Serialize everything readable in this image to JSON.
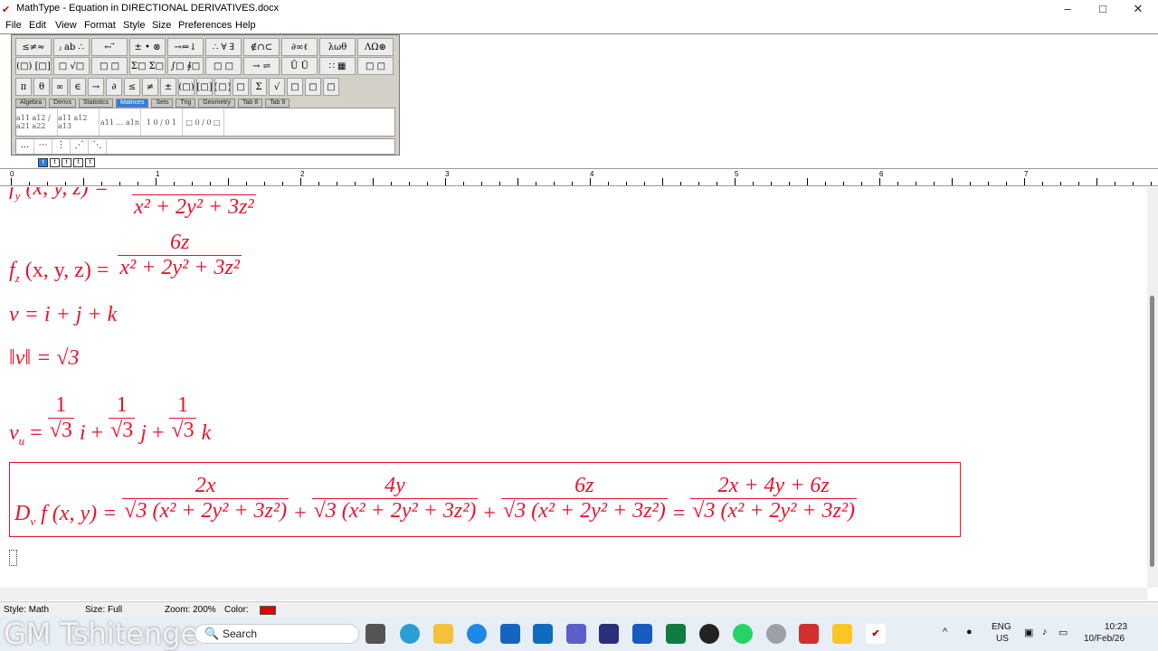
{
  "window": {
    "title": "MathType - Equation in DIRECTIONAL DERIVATIVES.docx",
    "minimize": "–",
    "maximize": "□",
    "close": "✕"
  },
  "menu": [
    "File",
    "Edit",
    "View",
    "Format",
    "Style",
    "Size",
    "Preferences",
    "Help"
  ],
  "palette": {
    "row1": [
      "≤≠≈",
      "ⱼ ab ∴",
      "← ⃗",
      "± • ⊗",
      "→⇔↓",
      "∴ ∀ ∃",
      "∉∩⊂",
      "∂∞ℓ",
      "λωθ",
      "ΛΩ⊛"
    ],
    "row2": [
      "(□) [□]",
      "□ √□",
      "□ □",
      "Σ□ Σ□",
      "∫□ ∮□",
      "□ □",
      "→ ⇌",
      "Ū Ŭ",
      "∷ ▦",
      "□ □"
    ],
    "row3": [
      "π",
      "θ",
      "∞",
      "∈",
      "→",
      "∂",
      "≤",
      "≠",
      "±",
      "(□)",
      "[□]",
      "{□}",
      "□",
      "Σ",
      "√",
      "□",
      "□",
      "□"
    ],
    "tabs": [
      "Algebra",
      "Derivs",
      "Statistics",
      "Matrices",
      "Sets",
      "Trig",
      "Geometry",
      "Tab 8",
      "Tab 9"
    ],
    "active_tab": "Matrices",
    "templates": [
      "a11 a12 / a21 a22",
      "a11 a12 a13",
      "a11 … a1n",
      "1 0 / 0 1",
      "□ 0 / 0 □"
    ],
    "dots": [
      "…",
      "⋯",
      "⋮",
      "⋰",
      "⋱"
    ]
  },
  "tabstops": [
    "t",
    "t",
    "t",
    "t",
    "t"
  ],
  "ruler": {
    "numbers": [
      "0",
      "1",
      "2",
      "3",
      "4",
      "5",
      "6",
      "7"
    ]
  },
  "equations": {
    "fy_top": {
      "lhs": "f",
      "sub": "y",
      "args": "(x, y, z) =",
      "den": "x² + 2y² + 3z²"
    },
    "fz": {
      "lhs": "f",
      "sub": "z",
      "args": "(x, y, z) =",
      "num": "6z",
      "den": "x² + 2y² + 3z²"
    },
    "v": {
      "text": "v = i + j + k"
    },
    "norm": {
      "text": "‖v‖ = √3"
    },
    "vu": {
      "lhs": "v",
      "sub": "u",
      "eq": "=",
      "one": "1",
      "sqrt3": "√3",
      "i": "i",
      "j": "j",
      "k": "k",
      "plus": "+"
    },
    "dvf": {
      "lhs": "D",
      "sub": "v",
      "args": "f (x, y) =",
      "t1num": "2x",
      "t2num": "4y",
      "t3num": "6z",
      "den": "√3 (x² + 2y² + 3z²)",
      "rnum": "2x + 4y + 6z",
      "plus": "+",
      "eq": "="
    }
  },
  "status": {
    "style": "Style: Math",
    "size": "Size: Full",
    "zoom": "Zoom: 200%",
    "color": "Color:",
    "swatch": "#e00000"
  },
  "taskbar": {
    "watermark": "GM Tshitenge",
    "search": "Search",
    "lang1": "ENG",
    "lang2": "US",
    "time": "10:23",
    "date": "10/Feb/26"
  }
}
